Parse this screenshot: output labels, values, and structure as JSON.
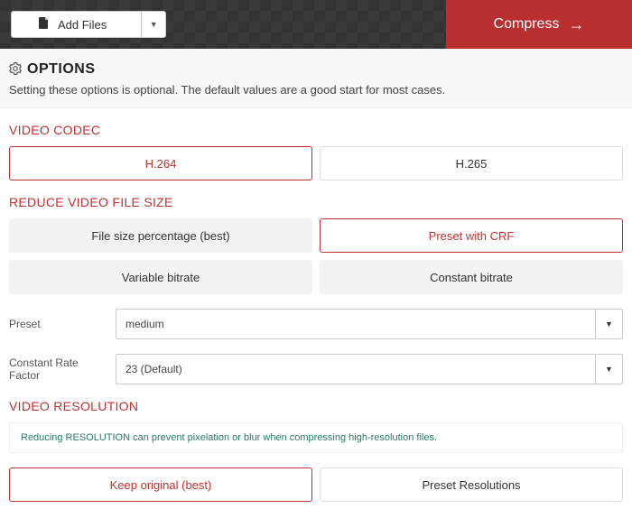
{
  "topbar": {
    "add_files_label": "Add Files",
    "compress_label": "Compress"
  },
  "options": {
    "heading": "OPTIONS",
    "description": "Setting these options is optional. The default values are a good start for most cases."
  },
  "codec": {
    "title": "VIDEO CODEC",
    "h264": "H.264",
    "h265": "H.265"
  },
  "reduce": {
    "title": "REDUCE VIDEO FILE SIZE",
    "pct": "File size percentage (best)",
    "crf": "Preset with CRF",
    "vbr": "Variable bitrate",
    "cbr": "Constant bitrate"
  },
  "preset": {
    "label": "Preset",
    "value": "medium"
  },
  "crf": {
    "label": "Constant Rate Factor",
    "value": "23 (Default)"
  },
  "resolution": {
    "title": "VIDEO RESOLUTION",
    "hint": "Reducing RESOLUTION can prevent pixelation or blur when compressing high-resolution files.",
    "keep": "Keep original (best)",
    "preset": "Preset Resolutions"
  }
}
